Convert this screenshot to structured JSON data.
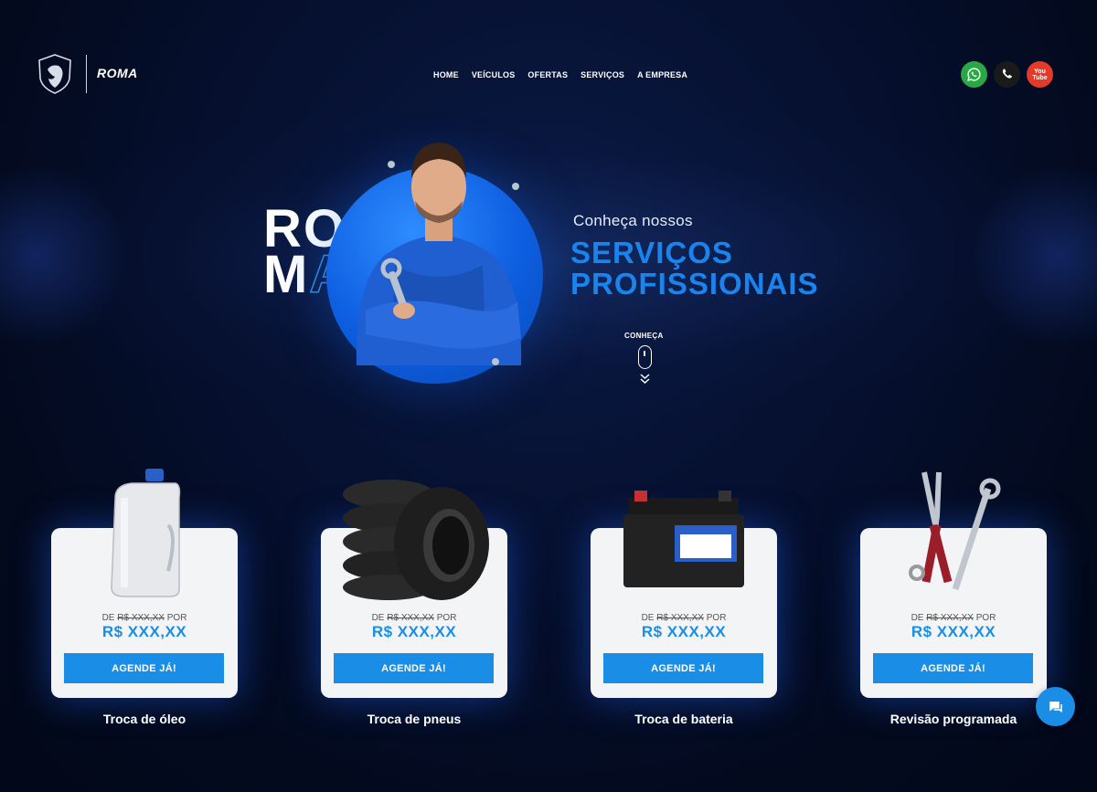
{
  "brand": {
    "name": "ROMA",
    "maker": "PEUGEOT"
  },
  "nav": [
    "HOME",
    "VEÍCULOS",
    "OFERTAS",
    "SERVIÇOS",
    "A EMPRESA"
  ],
  "social": [
    {
      "name": "whatsapp-icon",
      "color": "#2aa845"
    },
    {
      "name": "phone-icon",
      "color": "#1a1a1a"
    },
    {
      "name": "youtube-icon",
      "color": "#e43a2a",
      "label_top": "You",
      "label_bottom": "Tube"
    }
  ],
  "hero": {
    "roma_line1": "RO",
    "roma_line1_outline": "O",
    "roma_line2": "M",
    "roma_line2_outline": "A",
    "subtitle": "Conheça nossos",
    "title_line1": "SERVIÇOS",
    "title_line2": "PROFISSIONAIS",
    "scroll_label": "CONHEÇA"
  },
  "services": [
    {
      "label": "Troca de óleo",
      "price_prefix": "DE",
      "price_old": "R$ XXX,XX",
      "price_mid": "POR",
      "price_new": "R$ XXX,XX",
      "button": "AGENDE JÁ!",
      "icon": "oil-bottle-icon"
    },
    {
      "label": "Troca de pneus",
      "price_prefix": "DE",
      "price_old": "R$ XXX,XX",
      "price_mid": "POR",
      "price_new": "R$ XXX,XX",
      "button": "AGENDE JÁ!",
      "icon": "tires-icon"
    },
    {
      "label": "Troca de bateria",
      "price_prefix": "DE",
      "price_old": "R$ XXX,XX",
      "price_mid": "POR",
      "price_new": "R$ XXX,XX",
      "button": "AGENDE JÁ!",
      "icon": "battery-icon"
    },
    {
      "label": "Revisão programada",
      "price_prefix": "DE",
      "price_old": "R$ XXX,XX",
      "price_mid": "POR",
      "price_new": "R$ XXX,XX",
      "button": "AGENDE JÁ!",
      "icon": "tools-icon"
    }
  ],
  "colors": {
    "accent": "#1a8ee6",
    "background": "#030a1e",
    "card": "#f3f4f6"
  }
}
